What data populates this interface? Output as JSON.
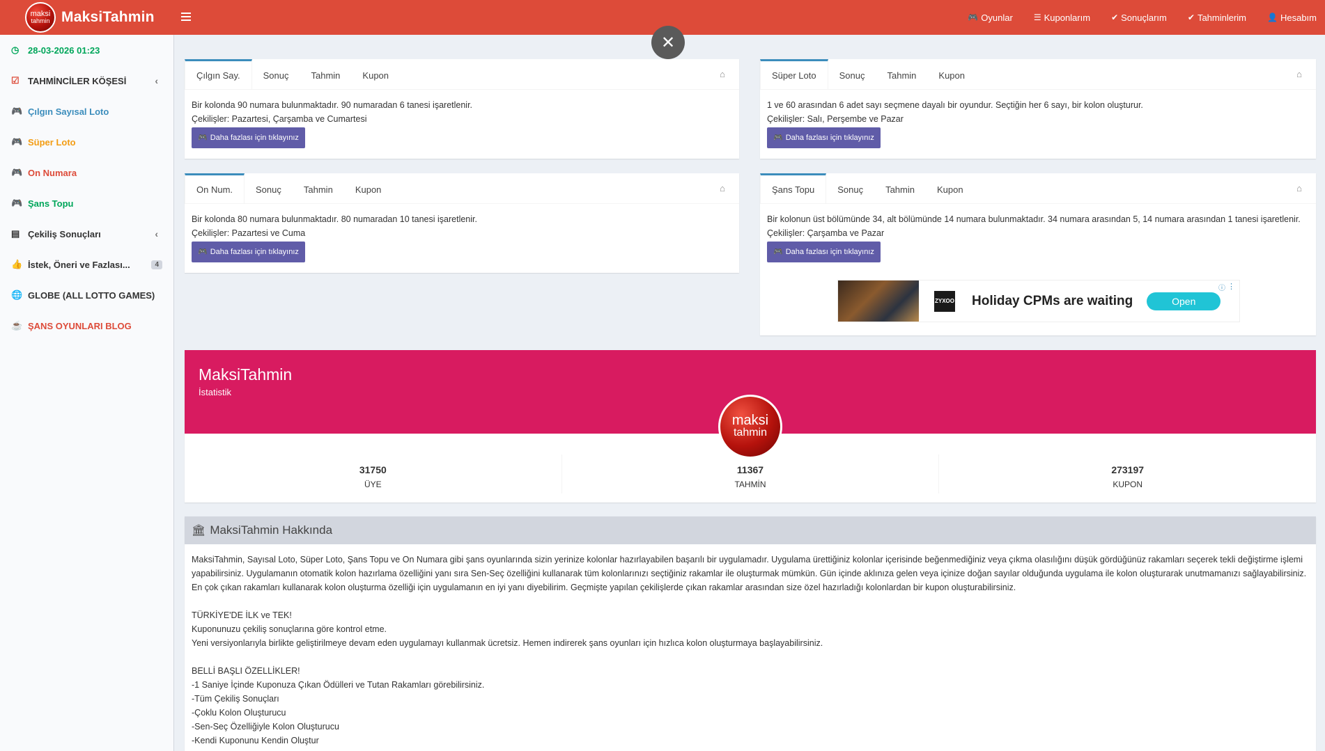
{
  "brand": {
    "logo_line1": "maksi",
    "logo_line2": "tahmin",
    "name": "MaksiTahmin"
  },
  "topnav": [
    {
      "icon": "gamepad-icon",
      "glyph": "🎮",
      "label": "Oyunlar"
    },
    {
      "icon": "list-icon",
      "glyph": "☰",
      "label": "Kuponlarım"
    },
    {
      "icon": "check-circle-icon",
      "glyph": "✔",
      "label": "Sonuçlarım"
    },
    {
      "icon": "check-icon",
      "glyph": "✔",
      "label": "Tahminlerim"
    },
    {
      "icon": "user-icon",
      "glyph": "👤",
      "label": "Hesabım"
    }
  ],
  "sidebar": {
    "datetime": "28-03-2026 01:23",
    "items": [
      {
        "label": "TAHMİNCİLER KÖŞESİ"
      },
      {
        "label": "Çılgın Sayısal Loto"
      },
      {
        "label": "Süper Loto"
      },
      {
        "label": "On Numara"
      },
      {
        "label": "Şans Topu"
      },
      {
        "label": "Çekiliş Sonuçları"
      },
      {
        "label": "İstek, Öneri ve Fazlası...",
        "badge": "4"
      },
      {
        "label": "GLOBE (ALL LOTTO GAMES)"
      },
      {
        "label": "ŞANS OYUNLARI BLOG"
      }
    ]
  },
  "close_label": "✕",
  "games": [
    {
      "tabs": [
        "Çılgın Say.",
        "Sonuç",
        "Tahmin",
        "Kupon"
      ],
      "desc": "Bir kolonda 90 numara bulunmaktadır. 90 numaradan 6 tanesi işaretlenir.",
      "draws": "Çekilişler: Pazartesi, Çarşamba ve Cumartesi",
      "button": "Daha fazlası için tıklayınız"
    },
    {
      "tabs": [
        "Süper Loto",
        "Sonuç",
        "Tahmin",
        "Kupon"
      ],
      "desc": "1 ve 60 arasından 6 adet sayı seçmene dayalı bir oyundur. Seçtiğin her 6 sayı, bir kolon oluşturur.",
      "draws": "Çekilişler: Salı, Perşembe ve Pazar",
      "button": "Daha fazlası için tıklayınız"
    },
    {
      "tabs": [
        "On Num.",
        "Sonuç",
        "Tahmin",
        "Kupon"
      ],
      "desc": "Bir kolonda 80 numara bulunmaktadır. 80 numaradan 10 tanesi işaretlenir.",
      "draws": "Çekilişler: Pazartesi ve Cuma",
      "button": "Daha fazlası için tıklayınız"
    },
    {
      "tabs": [
        "Şans Topu",
        "Sonuç",
        "Tahmin",
        "Kupon"
      ],
      "desc": "Bir kolonun üst bölümünde 34, alt bölümünde 14 numara bulunmaktadır. 34 numara arasından 5, 14 numara arasından 1 tanesi işaretlenir.",
      "draws": "Çekilişler: Çarşamba ve Pazar",
      "button": "Daha fazlası için tıklayınız"
    }
  ],
  "ad": {
    "brand": "ZYXOO",
    "title": "Holiday CPMs are waiting",
    "cta": "Open"
  },
  "profile": {
    "name": "MaksiTahmin",
    "subtitle": "İstatistik",
    "stats": [
      {
        "value": "31750",
        "label": "ÜYE"
      },
      {
        "value": "11367",
        "label": "TAHMİN"
      },
      {
        "value": "273197",
        "label": "KUPON"
      }
    ]
  },
  "about": {
    "title": "MaksiTahmin Hakkında",
    "p1": "MaksiTahmin, Sayısal Loto, Süper Loto, Şans Topu ve On Numara gibi şans oyunlarında sizin yerinize kolonlar hazırlayabilen başarılı bir uygulamadır. Uygulama ürettiğiniz kolonlar içerisinde beğenmediğiniz veya çıkma olasılığını düşük gördüğünüz rakamları seçerek tekli değiştirme işlemi yapabilirsiniz. Uygulamanın otomatik kolon hazırlama özelliğini yanı sıra Sen-Seç özelliğini kullanarak tüm kolonlarınızı seçtiğiniz rakamlar ile oluşturmak mümkün. Gün içinde aklınıza gelen veya içinize doğan sayılar olduğunda uygulama ile kolon oluşturarak unutmamanızı sağlayabilirsiniz. En çok çıkan rakamları kullanarak kolon oluşturma özelliği için uygulamanın en iyi yanı diyebilirim. Geçmişte yapılan çekilişlerde çıkan rakamlar arasından size özel hazırladığı kolonlardan bir kupon oluşturabilirsiniz.",
    "l1": "TÜRKİYE'DE İLK ve TEK!",
    "l2": "Kuponunuzu çekiliş sonuçlarına göre kontrol etme.",
    "l3": "Yeni versiyonlarıyla birlikte geliştirilmeye devam eden uygulamayı kullanmak ücretsiz. Hemen indirerek şans oyunları için hızlıca kolon oluşturmaya başlayabilirsiniz.",
    "l4": "BELLİ BAŞLI ÖZELLİKLER!",
    "f1": "-1 Saniye İçinde Kuponuza Çıkan Ödülleri ve Tutan Rakamları görebilirsiniz.",
    "f2": "-Tüm Çekiliş Sonuçları",
    "f3": "-Çoklu Kolon Oluşturucu",
    "f4": "-Sen-Seç Özelliğiyle Kolon Oluşturucu",
    "f5": "-Kendi Kuponunu Kendin Oluştur"
  }
}
